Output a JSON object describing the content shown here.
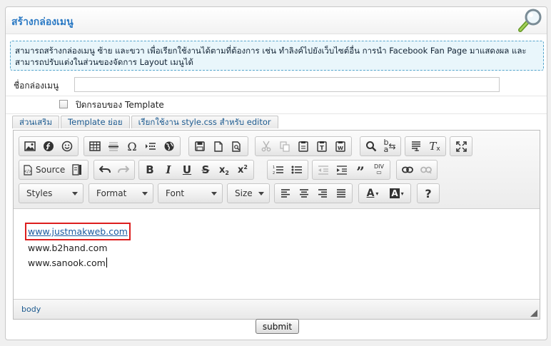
{
  "header": {
    "title": "สร้างกล่องเมนู",
    "icon": "magnifier-icon"
  },
  "info": {
    "text": "สามารถสร้างกล่องเมนู ซ้าย และขวา เพื่อเรียกใช้งานได้ตามที่ต้องการ เช่น ทำลิงค์ไปยังเว็บไซต์อื่น การนำ Facebook Fan Page มาแสดงผล และสามารถปรับแต่งในส่วนของจัดการ Layout เมนูได้"
  },
  "form": {
    "name_label": "ชื่อกล่องเมนู",
    "name_value": "",
    "hide_frame_label": "ปิดกรอบของ Template",
    "hide_frame_checked": false
  },
  "tabs": [
    {
      "label": "ส่วนเสริม"
    },
    {
      "label": "Template ย่อย"
    },
    {
      "label": "เรียกใช้งาน style.css สำหรับ editor"
    }
  ],
  "toolbar": {
    "source_label": "Source",
    "styles_label": "Styles",
    "format_label": "Format",
    "font_label": "Font",
    "size_label": "Size"
  },
  "content": {
    "lines": [
      "www.justmakweb.com",
      "www.b2hand.com",
      "www.sanook.com"
    ]
  },
  "status": {
    "path": "body"
  },
  "submit_label": "submit",
  "colors": {
    "title": "#2a79c4",
    "info_bg": "#e9f6fb",
    "info_border": "#55a5cc",
    "highlight_box": "#dd1e1e",
    "link": "#1a5aa0"
  }
}
